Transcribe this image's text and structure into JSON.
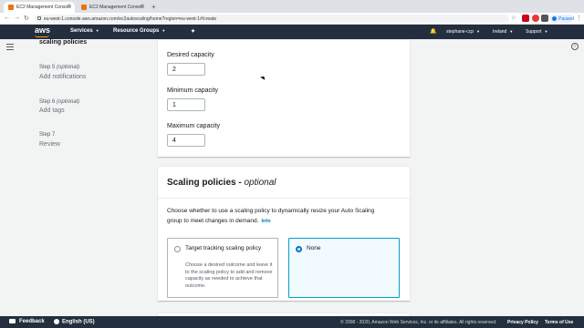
{
  "browser": {
    "tabs": [
      {
        "label": "EC2 Management Console",
        "active": true
      },
      {
        "label": "EC2 Management Console",
        "active": false
      }
    ],
    "url": "eu-west-1.console.aws.amazon.com/ec2autoscaling/home?region=eu-west-1#/create",
    "paused_label": "Paused"
  },
  "aws_nav": {
    "logo": "aws",
    "services": "Services",
    "resource_groups": "Resource Groups",
    "account": "stephane-ccp",
    "region": "Ireland",
    "support": "Support"
  },
  "steps": {
    "current_heading": "scaling policies",
    "items": [
      {
        "number": "Step 5",
        "optional": "(optional)",
        "title": "Add notifications"
      },
      {
        "number": "Step 6",
        "optional": "(optional)",
        "title": "Add tags"
      },
      {
        "number": "Step 7",
        "optional": "",
        "title": "Review"
      }
    ]
  },
  "capacity": {
    "desired_label": "Desired capacity",
    "desired_value": "2",
    "minimum_label": "Minimum capacity",
    "minimum_value": "1",
    "maximum_label": "Maximum capacity",
    "maximum_value": "4"
  },
  "scaling": {
    "title": "Scaling policies",
    "title_suffix": "optional",
    "description": "Choose whether to use a scaling policy to dynamically resize your Auto Scaling group to meet changes in demand.",
    "info_link": "Info",
    "options": [
      {
        "title": "Target tracking scaling policy",
        "description": "Choose a desired outcome and leave it to the scaling policy to add and remove capacity as needed to achieve that outcome.",
        "selected": false
      },
      {
        "title": "None",
        "description": "",
        "selected": true
      }
    ]
  },
  "footer": {
    "feedback": "Feedback",
    "language": "English (US)",
    "copyright": "© 2008 - 2020, Amazon Web Services, Inc. or its affiliates. All rights reserved.",
    "privacy": "Privacy Policy",
    "terms": "Terms of Use"
  },
  "colors": {
    "aws_nav_bg": "#232f3e",
    "accent": "#ff9900",
    "link": "#0073bb",
    "selected_tile_bg": "#f1faff"
  }
}
